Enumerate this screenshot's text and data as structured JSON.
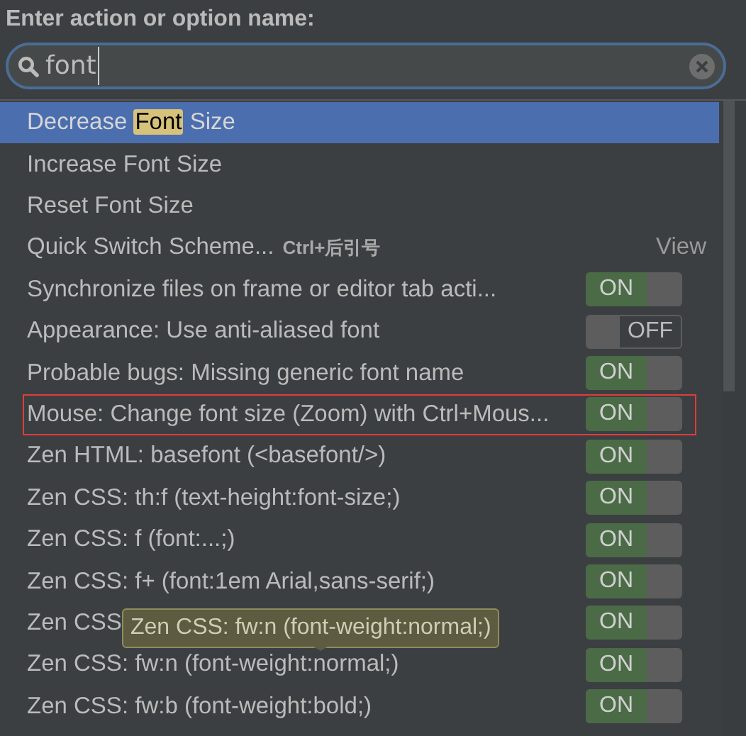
{
  "prompt": "Enter action or option name:",
  "search": {
    "value": "font"
  },
  "items": [
    {
      "kind": "action",
      "selected": true,
      "segments": [
        {
          "text": "Decrease ",
          "highlight": false
        },
        {
          "text": "Font",
          "highlight": true
        },
        {
          "text": " Size",
          "highlight": false
        }
      ]
    },
    {
      "kind": "action",
      "selected": false,
      "segments": [
        {
          "text": "Increase Font Size",
          "highlight": false
        }
      ]
    },
    {
      "kind": "action",
      "selected": false,
      "segments": [
        {
          "text": "Reset Font Size",
          "highlight": false
        }
      ]
    },
    {
      "kind": "action",
      "selected": false,
      "segments": [
        {
          "text": "Quick Switch Scheme...",
          "highlight": false
        }
      ],
      "shortcut": "Ctrl+后引号",
      "group": "View"
    },
    {
      "kind": "toggle",
      "selected": false,
      "on": true,
      "switch_text": "ON",
      "label": "Synchronize files on frame or editor tab acti..."
    },
    {
      "kind": "toggle",
      "selected": false,
      "on": false,
      "switch_text": "OFF",
      "label": "Appearance: Use anti-aliased font"
    },
    {
      "kind": "toggle",
      "selected": false,
      "on": true,
      "switch_text": "ON",
      "label": "Probable bugs: Missing generic font name"
    },
    {
      "kind": "toggle",
      "selected": false,
      "on": true,
      "switch_text": "ON",
      "outlined": true,
      "label": "Mouse: Change font size (Zoom) with Ctrl+Mous..."
    },
    {
      "kind": "toggle",
      "selected": false,
      "on": true,
      "switch_text": "ON",
      "label": "Zen HTML: basefont (<basefont/>)"
    },
    {
      "kind": "toggle",
      "selected": false,
      "on": true,
      "switch_text": "ON",
      "label": "Zen CSS: th:f (text-height:font-size;)"
    },
    {
      "kind": "toggle",
      "selected": false,
      "on": true,
      "switch_text": "ON",
      "label": "Zen CSS: f (font:...;)"
    },
    {
      "kind": "toggle",
      "selected": false,
      "on": true,
      "switch_text": "ON",
      "label": "Zen CSS: f+ (font:1em Arial,sans-serif;)"
    },
    {
      "kind": "toggle",
      "selected": false,
      "on": true,
      "switch_text": "ON",
      "label": "Zen CSS"
    },
    {
      "kind": "toggle",
      "selected": false,
      "on": true,
      "switch_text": "ON",
      "label": "Zen CSS: fw:n (font-weight:normal;)"
    },
    {
      "kind": "toggle",
      "selected": false,
      "on": true,
      "switch_text": "ON",
      "label": "Zen CSS: fw:b (font-weight:bold;)"
    }
  ],
  "tooltip": "Zen CSS: fw:n (font-weight:normal;)"
}
